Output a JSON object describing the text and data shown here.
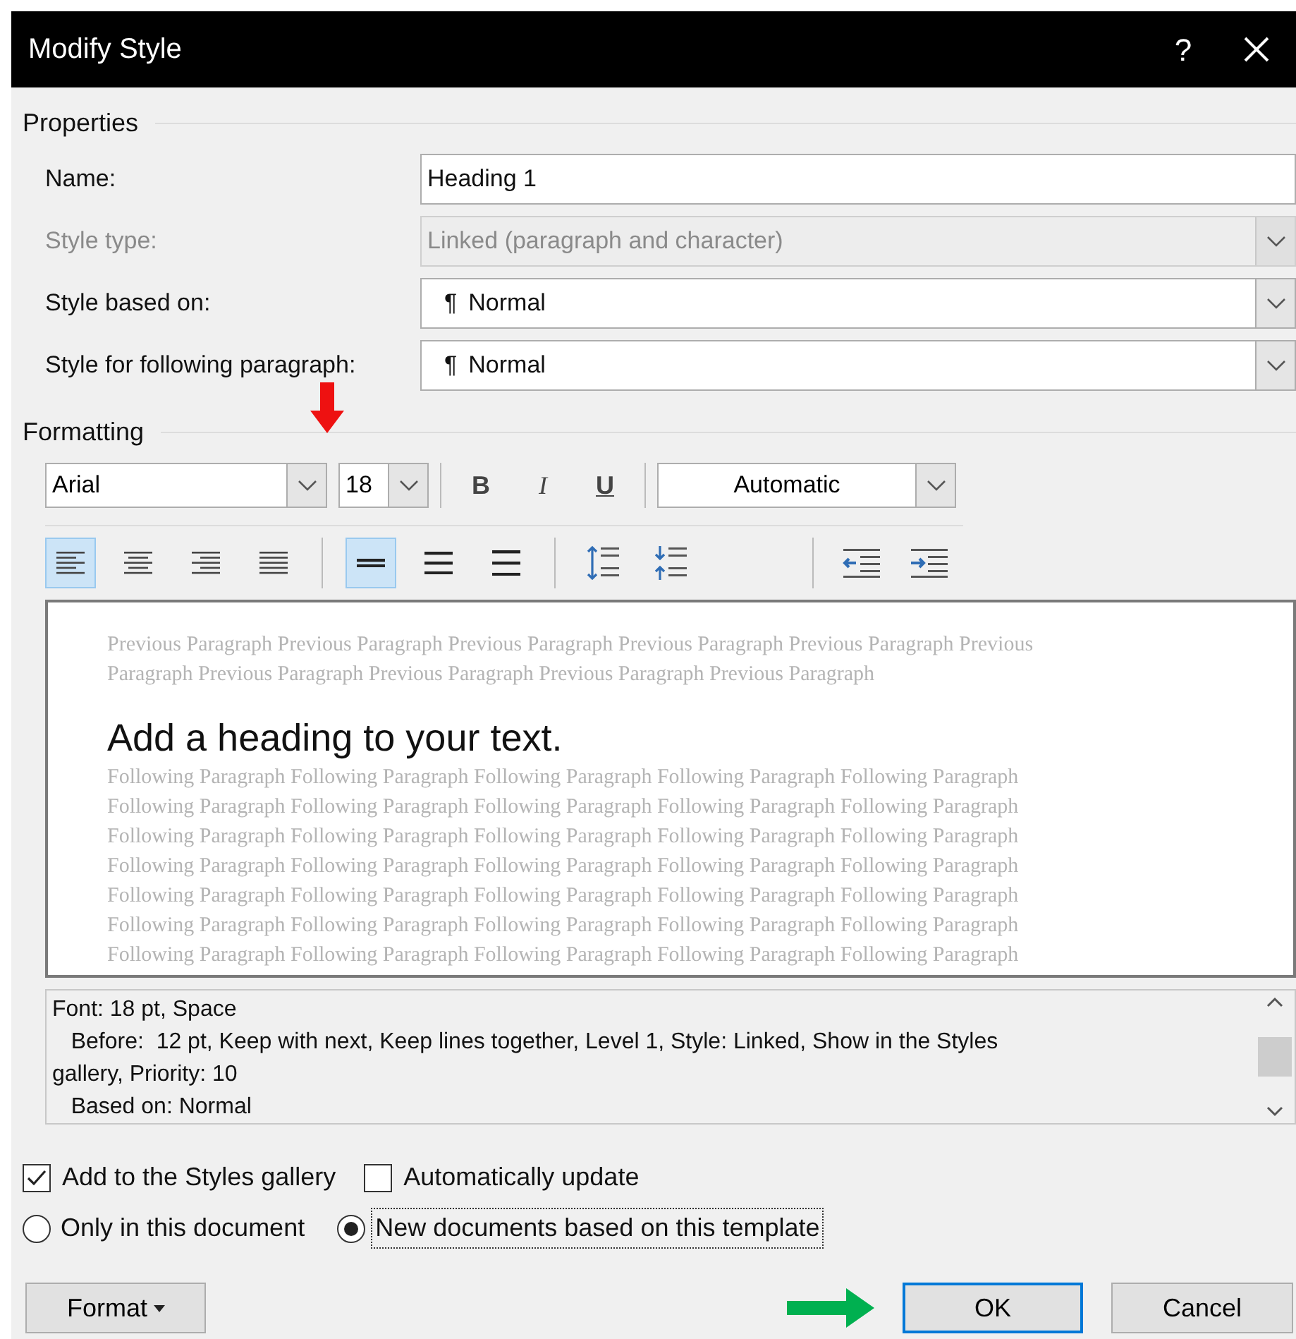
{
  "window": {
    "title": "Modify Style",
    "help": "?"
  },
  "properties": {
    "heading": "Properties",
    "fields": [
      {
        "label": "Name:",
        "kind": "text",
        "value": "Heading 1",
        "disabled": false
      },
      {
        "label": "Style type:",
        "kind": "dropdown",
        "value": "Linked (paragraph and character)",
        "disabled": true
      },
      {
        "label": "Style based on:",
        "kind": "dropdown",
        "mark": "¶",
        "value": "Normal",
        "disabled": false
      },
      {
        "label": "Style for following paragraph:",
        "kind": "dropdown",
        "mark": "¶",
        "value": "Normal",
        "disabled": false
      }
    ]
  },
  "formatting": {
    "heading": "Formatting",
    "font": "Arial",
    "size": "18",
    "bold": "B",
    "italic": "I",
    "underline": "U",
    "font_color_setting": "Automatic",
    "alignment": [
      {
        "kind": "left",
        "selected": true
      },
      {
        "kind": "center",
        "selected": false
      },
      {
        "kind": "right",
        "selected": false
      },
      {
        "kind": "justify",
        "selected": false
      }
    ],
    "line_spacing": [
      {
        "kind": "single",
        "selected": true
      },
      {
        "kind": "one-half",
        "selected": false
      },
      {
        "kind": "double",
        "selected": false
      }
    ],
    "paragraph_spacing": [
      {
        "kind": "increase"
      },
      {
        "kind": "decrease"
      }
    ],
    "indent": [
      {
        "kind": "decrease"
      },
      {
        "kind": "increase"
      }
    ]
  },
  "preview": {
    "previous": [
      "Previous Paragraph Previous Paragraph Previous Paragraph Previous Paragraph Previous Paragraph Previous",
      "Paragraph Previous Paragraph Previous Paragraph Previous Paragraph Previous Paragraph"
    ],
    "heading": "Add a heading to your text.",
    "following": [
      "Following Paragraph Following Paragraph Following Paragraph Following Paragraph Following Paragraph",
      "Following Paragraph Following Paragraph Following Paragraph Following Paragraph Following Paragraph",
      "Following Paragraph Following Paragraph Following Paragraph Following Paragraph Following Paragraph",
      "Following Paragraph Following Paragraph Following Paragraph Following Paragraph Following Paragraph",
      "Following Paragraph Following Paragraph Following Paragraph Following Paragraph Following Paragraph",
      "Following Paragraph Following Paragraph Following Paragraph Following Paragraph Following Paragraph",
      "Following Paragraph Following Paragraph Following Paragraph Following Paragraph Following Paragraph"
    ]
  },
  "description": [
    "Font: 18 pt, Space",
    "   Before:  12 pt, Keep with next, Keep lines together, Level 1, Style: Linked, Show in the Styles",
    "gallery, Priority: 10",
    "   Based on: Normal"
  ],
  "checkboxes": [
    {
      "label": "Add to the Styles gallery",
      "checked": true
    },
    {
      "label": "Automatically update",
      "checked": false
    }
  ],
  "radios": [
    {
      "label": "Only in this document",
      "selected": false
    },
    {
      "label": "New documents based on this template",
      "selected": true
    }
  ],
  "buttons": {
    "format": "Format",
    "ok": "OK",
    "cancel": "Cancel"
  }
}
